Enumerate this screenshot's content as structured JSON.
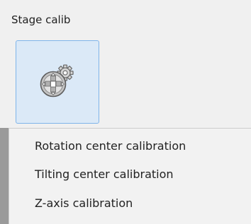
{
  "group": {
    "label": "Stage calib",
    "button": {
      "icon": "stage-calibration-gear-icon"
    }
  },
  "menu": {
    "items": [
      {
        "label": "Rotation center calibration"
      },
      {
        "label": "Tilting center calibration"
      },
      {
        "label": "Z-axis calibration"
      }
    ]
  }
}
